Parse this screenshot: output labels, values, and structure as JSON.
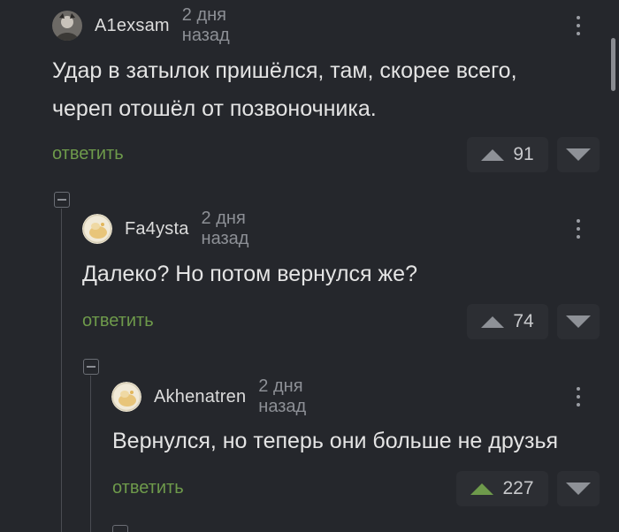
{
  "comments": [
    {
      "username": "A1exsam",
      "time": "2 дня назад",
      "text_lines": [
        "Удар в затылок пришёлся, там, скорее всего,",
        "череп отошёл от позвоночника."
      ],
      "reply_label": "ответить",
      "score": "91",
      "upvoted": false,
      "avatar_icon": "user-photo-avatar"
    },
    {
      "username": "Fa4ysta",
      "time": "2 дня назад",
      "text_lines": [
        "Далеко? Но потом вернулся же?"
      ],
      "reply_label": "ответить",
      "score": "74",
      "upvoted": false,
      "avatar_icon": "default-avatar"
    },
    {
      "username": "Akhenatren",
      "time": "2 дня назад",
      "text_lines": [
        "Вернулся, но теперь они больше не друзья"
      ],
      "reply_label": "ответить",
      "score": "227",
      "upvoted": true,
      "avatar_icon": "default-avatar"
    }
  ],
  "colors": {
    "background": "#25272c",
    "reply": "#6e9a4b",
    "upvote_active": "#6e9a4b",
    "vote_box": "#2c2e33"
  }
}
